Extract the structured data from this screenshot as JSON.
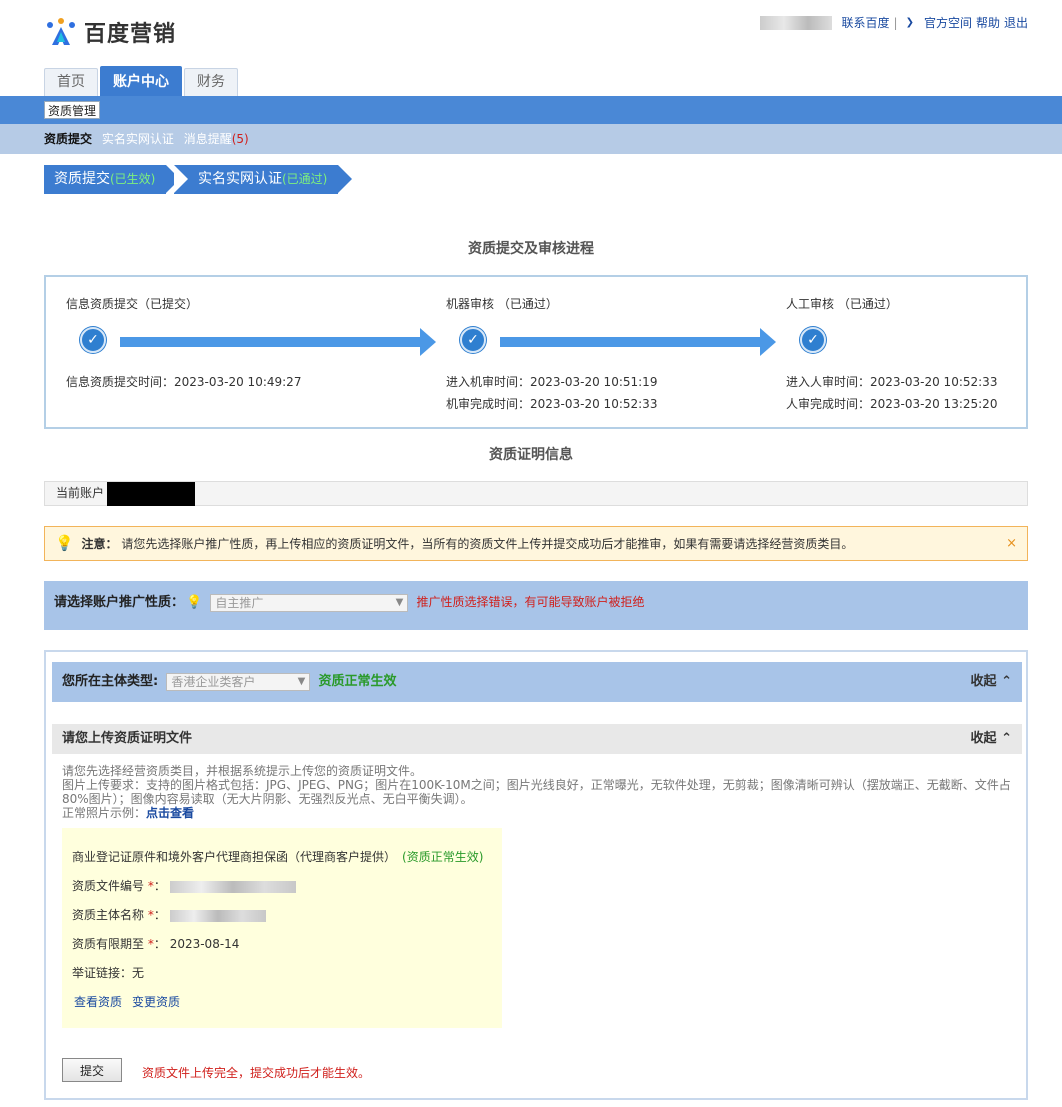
{
  "header": {
    "logo_text": "百度营销",
    "links": {
      "contact": "联系百度",
      "official": "官方空间",
      "help": "帮助",
      "logout": "退出"
    }
  },
  "tabs": [
    {
      "label": "首页",
      "active": false
    },
    {
      "label": "账户中心",
      "active": true
    },
    {
      "label": "财务",
      "active": false
    }
  ],
  "subnav": {
    "section": "资质管理"
  },
  "subtabs": {
    "current": "资质提交",
    "realname": "实名实网认证",
    "messages": "消息提醒",
    "message_count": "(5)"
  },
  "steps": [
    {
      "label": "资质提交",
      "status": "(已生效)"
    },
    {
      "label": "实名实网认证",
      "status": "(已通过)"
    }
  ],
  "progress": {
    "title": "资质提交及审核进程",
    "stages": [
      {
        "title": "信息资质提交（已提交）",
        "times": [
          "信息资质提交时间：2023-03-20 10:49:27"
        ]
      },
      {
        "title": "机器审核 （已通过）",
        "times": [
          "进入机审时间：2023-03-20 10:51:19",
          "机审完成时间：2023-03-20 10:52:33"
        ]
      },
      {
        "title": "人工审核 （已通过）",
        "times": [
          "进入人审时间：2023-03-20 10:52:33",
          "人审完成时间：2023-03-20 13:25:20"
        ]
      }
    ]
  },
  "cert": {
    "title": "资质证明信息",
    "account_label": "当前账户",
    "notice_label": "注意：",
    "notice_text": "请您先选择账户推广性质，再上传相应的资质证明文件，当所有的资质文件上传并提交成功后才能推审，如果有需要请选择经营资质类目。",
    "notice_close": "×",
    "promo_label": "请选择账户推广性质：",
    "promo_value": "自主推广",
    "promo_error": "推广性质选择错误，有可能导致账户被拒绝",
    "entity_label": "您所在主体类型:",
    "entity_value": "香港企业类客户",
    "entity_status": "资质正常生效",
    "collapse": "收起",
    "upload_title": "请您上传资质证明文件",
    "req_line1": "请您先选择经营资质类目，并根据系统提示上传您的资质证明文件。",
    "req_line2": "图片上传要求：支持的图片格式包括：JPG、JPEG、PNG；图片在100K-10M之间；图片光线良好，正常曝光，无软件处理，无剪裁；图像清晰可辨认（摆放端正、无截断、文件占80%图片）；图像内容易读取（无大片阴影、无强烈反光点、无白平衡失调）。",
    "req_line3": "正常照片示例：",
    "req_link": "点击查看",
    "doc_title": "商业登记证原件和境外客户代理商担保函（代理商客户提供）",
    "doc_status": "(资质正常生效)",
    "doc_no_label": "资质文件编号",
    "doc_name_label": "资质主体名称",
    "doc_expiry_label": "资质有限期至",
    "doc_expiry_value": "2023-08-14",
    "doc_link_label": "举证链接：",
    "doc_link_value": "无",
    "view": "查看资质",
    "change": "变更资质",
    "required_mark": "*",
    "colon": "：",
    "submit": "提交",
    "submit_tip": "资质文件上传完全，提交成功后才能生效。"
  }
}
